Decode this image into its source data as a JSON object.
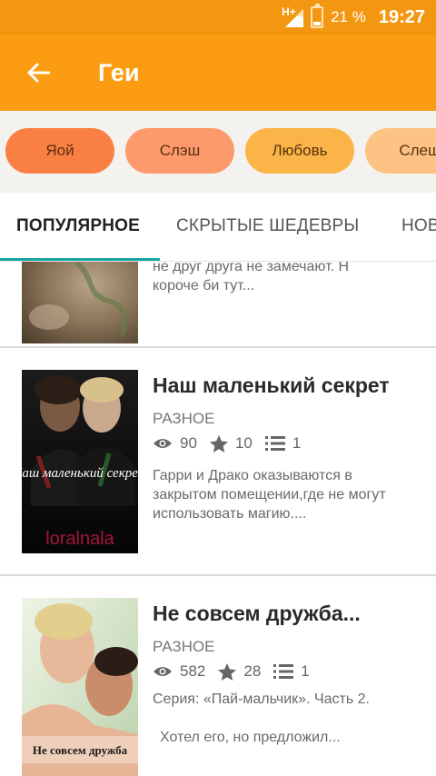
{
  "status_bar": {
    "network": "H+",
    "battery_level": 0.21,
    "battery": "21 %",
    "time": "19:27"
  },
  "app_bar": {
    "title": "Геи",
    "back_icon": "arrow-left-icon"
  },
  "colors": {
    "status_bar": "#f49710",
    "app_bar": "#fb9c12",
    "tab_indicator": "#1aa3a3"
  },
  "chips": [
    {
      "label": "Яой",
      "color": "#fa7f43"
    },
    {
      "label": "Слэш",
      "color": "#fc9a6c"
    },
    {
      "label": "Любовь",
      "color": "#fbb447"
    },
    {
      "label": "Слеш",
      "color": "#fcc384"
    }
  ],
  "tabs": [
    {
      "label": "ПОПУЛЯРНОЕ",
      "active": true
    },
    {
      "label": "СКРЫТЫЕ ШЕДЕВРЫ",
      "active": false
    },
    {
      "label": "НОВ",
      "active": false
    }
  ],
  "stories": [
    {
      "desc_partial_top": "не друг друга не замечают. Н",
      "desc": "короче би тут..."
    },
    {
      "title": "Наш маленький секрет",
      "category": "РАЗНОЕ",
      "views": "90",
      "votes": "10",
      "parts": "1",
      "desc": "Гарри и Драко оказываются в закрытом помещении,где не могут использовать магию....",
      "cover_title": "Наш маленький секрет",
      "cover_author": "loralnala"
    },
    {
      "title": "Не совсем дружба...",
      "category": "РАЗНОЕ",
      "views": "582",
      "votes": "28",
      "parts": "1",
      "series": "Серия: «Пай-мальчик». Часть 2.",
      "desc": "Хотел его, но предложил...",
      "cover_title": "Не совсем дружба"
    }
  ]
}
